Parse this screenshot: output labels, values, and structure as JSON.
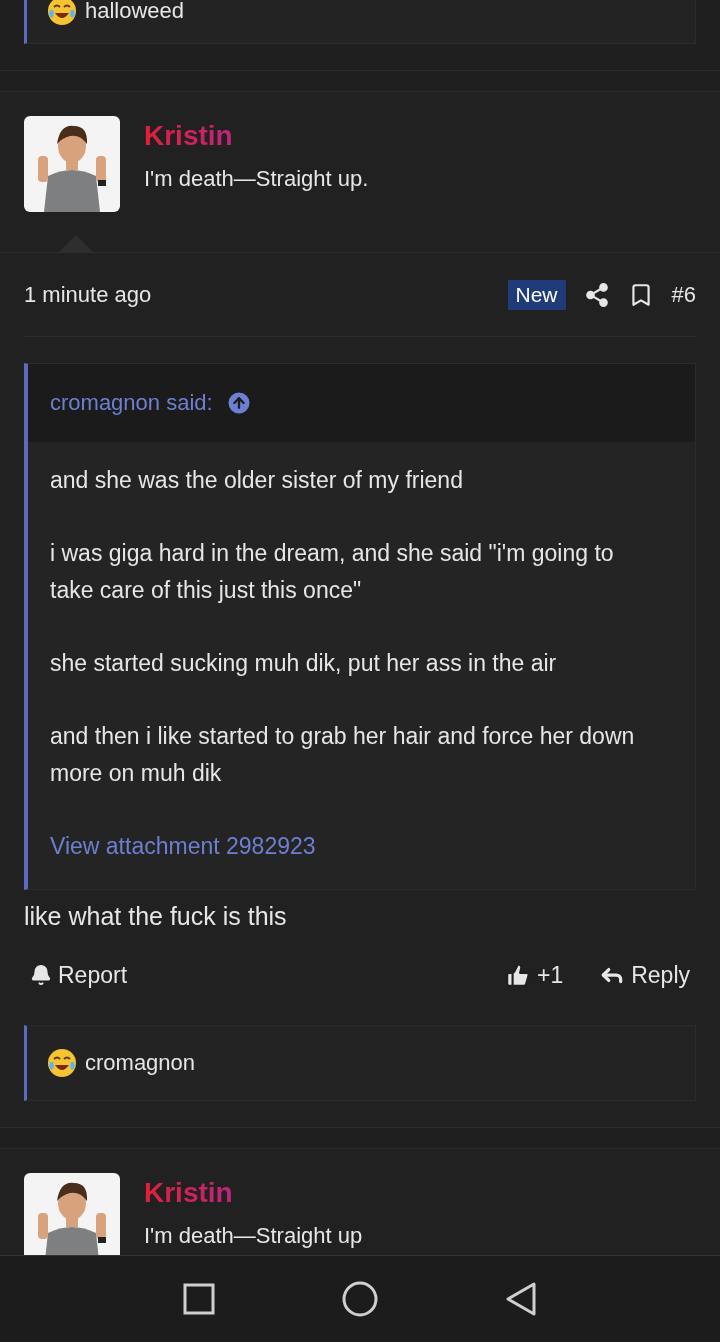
{
  "top_reaction": {
    "users": "halloweed"
  },
  "posts": [
    {
      "author": "Kristin",
      "user_title": "I'm death—Straight up.",
      "time": "1 minute ago",
      "badge": "New",
      "number": "#6",
      "quote": {
        "author": "cromagnon said:",
        "paragraphs": [
          "and she was the older sister of my friend",
          "i was giga hard in the dream, and she said \"i'm going to take care of this just this once\"",
          "she started sucking muh dik, put her ass in the air",
          "and then i like started to grab her hair and force her down more on muh dik"
        ],
        "attachment": "View attachment 2982923"
      },
      "body": "like what the fuck is this",
      "actions": {
        "report": "Report",
        "likes": "+1",
        "reply": "Reply"
      },
      "reaction": {
        "users": "cromagnon"
      }
    },
    {
      "author": "Kristin",
      "user_title": "I'm death—Straight up"
    }
  ]
}
